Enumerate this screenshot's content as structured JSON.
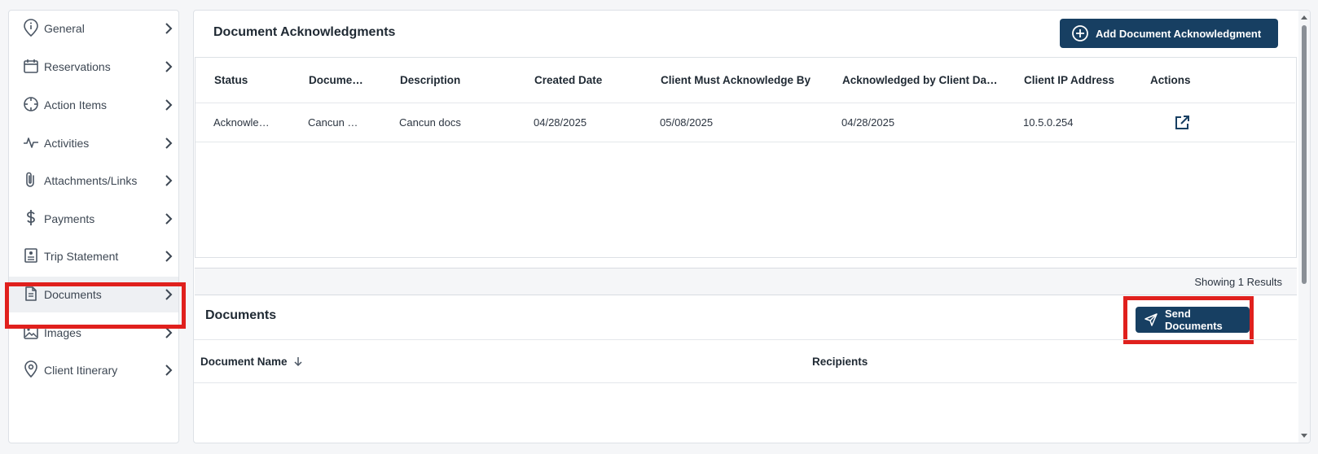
{
  "sidebar": {
    "items": [
      {
        "label": "General",
        "icon": "info-pin-icon"
      },
      {
        "label": "Reservations",
        "icon": "calendar-icon"
      },
      {
        "label": "Action Items",
        "icon": "crosshair-icon"
      },
      {
        "label": "Activities",
        "icon": "pulse-icon"
      },
      {
        "label": "Attachments/Links",
        "icon": "paperclip-icon"
      },
      {
        "label": "Payments",
        "icon": "dollar-icon"
      },
      {
        "label": "Trip Statement",
        "icon": "statement-icon"
      },
      {
        "label": "Documents",
        "icon": "document-icon",
        "active": true
      },
      {
        "label": "Images",
        "icon": "image-icon"
      },
      {
        "label": "Client Itinerary",
        "icon": "location-pin-icon"
      }
    ]
  },
  "acknowledgments": {
    "title": "Document Acknowledgments",
    "add_button": "Add Document Acknowledgment",
    "columns": [
      "Status",
      "Docume…",
      "Description",
      "Created Date",
      "Client Must Acknowledge By",
      "Acknowledged by Client Da…",
      "Client IP Address",
      "Actions"
    ],
    "rows": [
      {
        "status": "Acknowle…",
        "document": "Cancun …",
        "description": "Cancun docs",
        "created": "04/28/2025",
        "must_ack_by": "05/08/2025",
        "acknowledged": "04/28/2025",
        "ip": "10.5.0.254",
        "action_icon": "open-external-icon"
      }
    ],
    "showing": "Showing 1 Results"
  },
  "documents": {
    "title": "Documents",
    "send_button": "Send Documents",
    "columns": [
      "Document Name",
      "Recipients"
    ],
    "sort_icon": "arrow-down-icon"
  },
  "colors": {
    "primary": "#173f62",
    "highlight": "#e0201d"
  }
}
